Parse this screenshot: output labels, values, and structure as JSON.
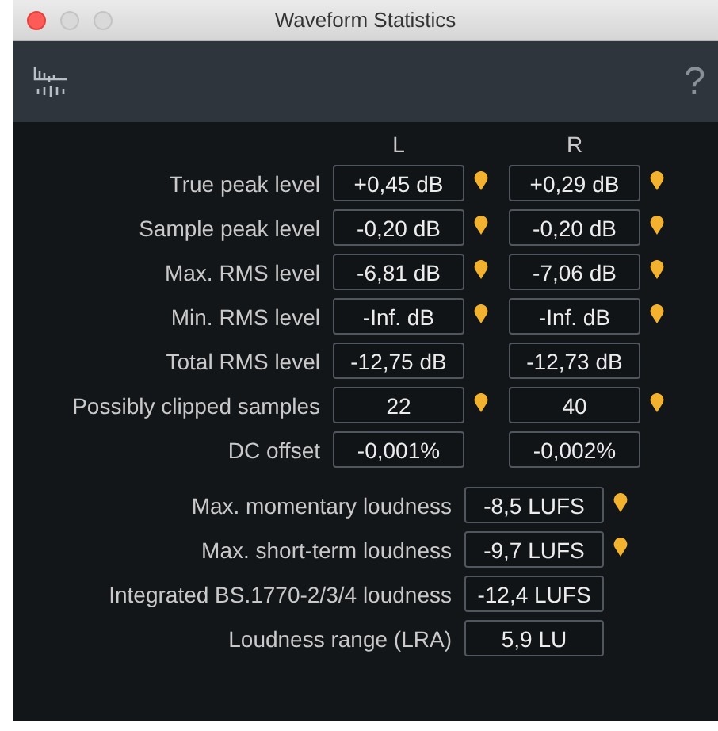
{
  "window": {
    "title": "Waveform Statistics"
  },
  "toolbar": {
    "help": "?"
  },
  "columns": [
    "L",
    "R"
  ],
  "channel_stats": [
    {
      "label": "True peak level",
      "values": [
        {
          "text": "+0,45 dB",
          "flagged": true
        },
        {
          "text": "+0,29 dB",
          "flagged": true
        }
      ]
    },
    {
      "label": "Sample peak level",
      "values": [
        {
          "text": "-0,20 dB",
          "flagged": true
        },
        {
          "text": "-0,20 dB",
          "flagged": true
        }
      ]
    },
    {
      "label": "Max. RMS level",
      "values": [
        {
          "text": "-6,81 dB",
          "flagged": true
        },
        {
          "text": "-7,06 dB",
          "flagged": true
        }
      ]
    },
    {
      "label": "Min. RMS level",
      "values": [
        {
          "text": "-Inf. dB",
          "flagged": true
        },
        {
          "text": "-Inf. dB",
          "flagged": true
        }
      ]
    },
    {
      "label": "Total RMS level",
      "values": [
        {
          "text": "-12,75 dB",
          "flagged": false
        },
        {
          "text": "-12,73 dB",
          "flagged": false
        }
      ]
    },
    {
      "label": "Possibly clipped samples",
      "values": [
        {
          "text": "22",
          "flagged": true
        },
        {
          "text": "40",
          "flagged": true
        }
      ]
    },
    {
      "label": "DC offset",
      "values": [
        {
          "text": "-0,001%",
          "flagged": false
        },
        {
          "text": "-0,002%",
          "flagged": false
        }
      ]
    }
  ],
  "loudness": [
    {
      "label": "Max. momentary loudness",
      "value": "-8,5 LUFS",
      "flagged": true
    },
    {
      "label": "Max. short-term loudness",
      "value": "-9,7 LUFS",
      "flagged": true
    },
    {
      "label": "Integrated BS.1770-2/3/4 loudness",
      "value": "-12,4 LUFS",
      "flagged": false
    },
    {
      "label": "Loudness range (LRA)",
      "value": "5,9 LU",
      "flagged": false
    }
  ]
}
